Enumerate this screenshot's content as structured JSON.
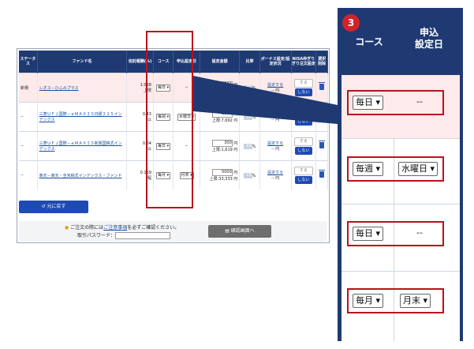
{
  "table": {
    "headers": [
      "ステータス",
      "ファンド名",
      "信託報酬(%)",
      "コース",
      "申込設定日",
      "設定金額",
      "比率",
      "ボーナス設定/設定状況",
      "NISA枠ぎりぎり注文設定",
      "選択削除"
    ],
    "rows": [
      {
        "status": "新規",
        "fund": "レオス－ひふみプラス",
        "fee": "1.058",
        "fee_sub": "上限",
        "course": "毎日 ▾",
        "date": "--",
        "amount": "500",
        "unit": "円",
        "limit": "上限:1,619 円",
        "ratio": "31",
        "pct": "%",
        "bonus": "設定する",
        "bonus_sub": "-- 円",
        "suru": "する",
        "shinai": "しない"
      },
      {
        "status": "--",
        "fund": "三菱ＵＦＪ国際－ｅＭＡＸＩＳ日経２２５インデックス",
        "fee": "0.43",
        "fee_sub": "以",
        "course": "毎週 ▾",
        "date": "水曜日 ▾",
        "amount": "2500",
        "unit": "円",
        "limit": "上限:7,692 円",
        "ratio": "33",
        "pct": "%",
        "bonus": "設定する",
        "bonus_sub": "-- 円",
        "suru": "",
        "shinai": "しない"
      },
      {
        "status": "--",
        "fund": "三菱ＵＦＪ国際－ｅＭＡＸＩＳ新興国株式インデックス",
        "fee": "0.64",
        "fee_sub": "以",
        "course": "毎日 ▾",
        "date": "--",
        "amount": "300",
        "unit": "円",
        "limit": "上限:1,619 円",
        "ratio": "19",
        "pct": "%",
        "bonus": "設定する",
        "bonus_sub": "-- 円",
        "suru": "する",
        "shinai": "しない"
      },
      {
        "status": "--",
        "fund": "楽天－楽天・全米株式インデックス・ファンド",
        "fee": "0.169",
        "fee_sub": "程",
        "course": "毎月 ▾",
        "date": "月末 ▾",
        "amount": "5000",
        "unit": "円",
        "limit": "上限:33,333 円",
        "ratio": "15",
        "pct": "%",
        "bonus": "設定する",
        "bonus_sub": "-- 円",
        "suru": "する",
        "shinai": "しない"
      }
    ]
  },
  "back_button": "元に戻す",
  "notice": {
    "pre": "ご注文の際には",
    "link": "ご注意事項",
    "post": "を必ずご確認ください。",
    "password_label": "取引パスワード："
  },
  "confirm_button": "確認画面へ",
  "zoom": {
    "badge": "3",
    "header_course": "コース",
    "header_date": "申込\n設定日",
    "rows": [
      {
        "course": "毎日 ▾",
        "date": "--"
      },
      {
        "course": "毎週 ▾",
        "date": "水曜日 ▾"
      },
      {
        "course": "毎日 ▾",
        "date": "--"
      },
      {
        "course": "毎月 ▾",
        "date": "月末 ▾"
      }
    ]
  }
}
